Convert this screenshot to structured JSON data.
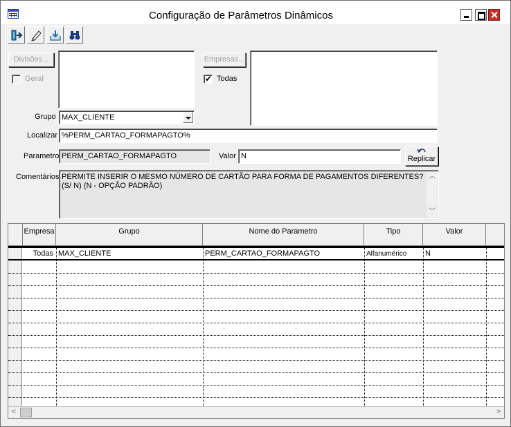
{
  "window": {
    "title": "Configuração de Parâmetros Dinâmicos"
  },
  "toolbar": {
    "buttons": [
      {
        "icon": "exit-door-icon"
      },
      {
        "icon": "pencil-edit-icon"
      },
      {
        "icon": "import-tray-icon"
      },
      {
        "icon": "binoculars-icon"
      }
    ]
  },
  "form": {
    "divisoes_button": "Divisões...",
    "geral_label": "Geral",
    "geral_checked": false,
    "empresas_button": "Empresas...",
    "todas_label": "Todas",
    "todas_checked": true,
    "grupo_label": "Grupo",
    "grupo_value": "MAX_CLIENTE",
    "localizar_label": "Localizar",
    "localizar_value": "%PERM_CARTAO_FORMAPAGTO%",
    "parametro_label": "Parametro",
    "parametro_value": "PERM_CARTAO_FORMAPAGTO",
    "valor_label": "Valor",
    "valor_value": "N",
    "replicar_button": "Replicar",
    "comentarios_label": "Comentários",
    "comentarios_line1": "PERMITE INSERIR O MESMO NÚMERO DE CARTÃO PARA FORMA DE PAGAMENTOS DIFERENTES?",
    "comentarios_line2": "(S/ N) (N - OPÇÃO PADRÃO)"
  },
  "grid": {
    "columns": [
      "Empresa",
      "Grupo",
      "Nome do Parametro",
      "Tipo",
      "Valor"
    ],
    "rows": [
      {
        "empresa": "Todas",
        "grupo": "MAX_CLIENTE",
        "nome": "PERM_CARTAO_FORMAPAGTO",
        "tipo": "Alfanumérico",
        "valor": "N"
      }
    ]
  }
}
